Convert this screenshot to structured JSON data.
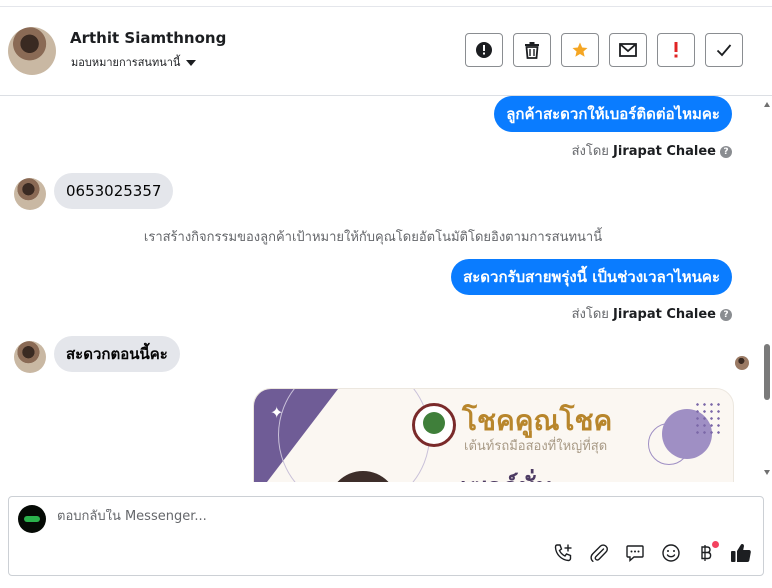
{
  "contact": {
    "name": "Arthit Siamthnong",
    "assign_label": "มอบหมายการสนทนานี้"
  },
  "header_actions": [
    {
      "name": "spam-icon",
      "glyph": "!"
    },
    {
      "name": "trash-icon"
    },
    {
      "name": "star-icon"
    },
    {
      "name": "envelope-icon"
    },
    {
      "name": "follow-up-icon",
      "glyph": "!"
    },
    {
      "name": "done-icon",
      "glyph": "✓"
    }
  ],
  "messages": [
    {
      "direction": "out",
      "text": "ลูกค้าสะดวกให้เบอร์ติดต่อไหมคะ",
      "sent_by_prefix": "ส่งโดย",
      "sent_by": "Jirapat Chalee"
    },
    {
      "direction": "in",
      "text": "0653025357"
    },
    {
      "direction": "system",
      "text": "เราสร้างกิจกรรมของลูกค้าเป้าหมายให้กับคุณโดยอัตโนมัติโดยอิงตามการสนทนานี้"
    },
    {
      "direction": "out",
      "text": "สะดวกรับสายพรุ่งนี้ เป็นช่วงเวลาไหนคะ",
      "sent_by_prefix": "ส่งโดย",
      "sent_by": "Jirapat Chalee"
    },
    {
      "direction": "in",
      "text": "สะดวกตอนนี้คะ"
    }
  ],
  "promo_card": {
    "headline": "โชคคูณโชค",
    "subtitle": "เต้นท์รถมือสองที่ใหญ่ที่สุด",
    "big_text": "เซลล์มั่น"
  },
  "composer": {
    "placeholder": "ตอบกลับใน Messenger..."
  },
  "composer_tools": [
    "phone-plus-icon",
    "paperclip-icon",
    "saved-replies-icon",
    "emoji-icon",
    "baht-icon",
    "thumbs-up-icon"
  ],
  "colors": {
    "outgoing_bubble": "#0a7cff",
    "incoming_bubble": "#e4e6eb",
    "star": "#f5a623",
    "follow_up": "#e02424"
  }
}
